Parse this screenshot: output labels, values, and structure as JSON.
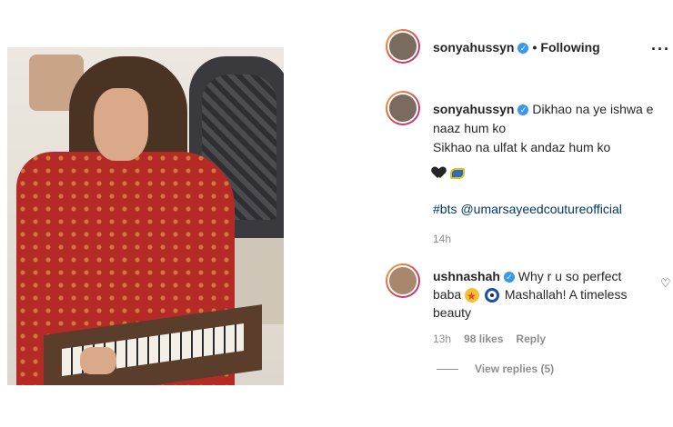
{
  "post": {
    "username": "sonyahussyn",
    "follow_status": "Following",
    "more_icon": "more-horizontal-icon"
  },
  "caption": {
    "username": "sonyahussyn",
    "lines": [
      "Dikhao na ye ishwa e",
      "naaz hum ko",
      "Sikhao na ulfat k andaz hum ko"
    ],
    "emojis": [
      "black-heart-icon",
      "puzzle-emoji-icon"
    ],
    "hashtag": "#bts",
    "mention": "@umarsayeedcoutureofficial",
    "time": "14h"
  },
  "comment": {
    "username": "ushnashah",
    "text_part1": "Why r u so perfect baba",
    "text_part2": "Mashallah! A timeless beauty",
    "time": "13h",
    "likes": "98 likes",
    "reply_label": "Reply",
    "view_replies": "View replies (5)"
  },
  "colors": {
    "verified": "#3897f0",
    "link": "#00376b",
    "muted": "#8e8e8e"
  }
}
